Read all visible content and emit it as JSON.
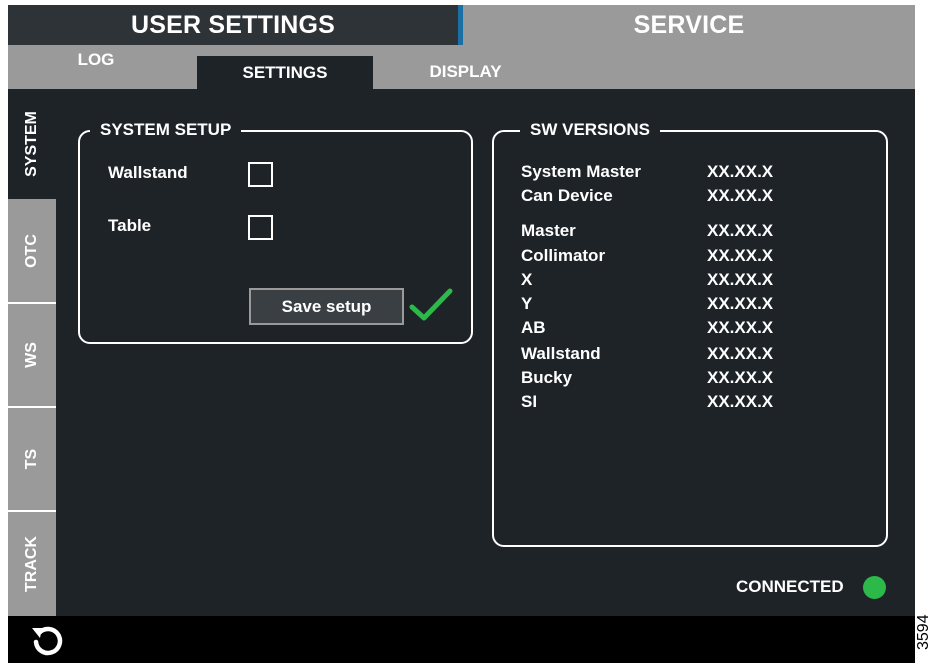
{
  "header": {
    "user_settings": "USER SETTINGS",
    "service": "SERVICE"
  },
  "subtabs": [
    "LOG",
    "SETTINGS",
    "DISPLAY"
  ],
  "sidetabs": [
    "SYSTEM",
    "OTC",
    "WS",
    "TS",
    "TRACK"
  ],
  "active_sidetab": "SYSTEM",
  "active_subtab": "SETTINGS",
  "system_setup": {
    "title": "SYSTEM SETUP",
    "wallstand_label": "Wallstand",
    "wallstand_checked": false,
    "table_label": "Table",
    "table_checked": false,
    "save_label": "Save setup"
  },
  "sw_versions": {
    "title": "SW VERSIONS",
    "rows": [
      {
        "name": "System Master",
        "version": "XX.XX.X"
      },
      {
        "name": "Can Device",
        "version": "XX.XX.X"
      },
      {
        "name": "Master",
        "version": "XX.XX.X"
      },
      {
        "name": "Collimator",
        "version": "XX.XX.X"
      },
      {
        "name": "X",
        "version": "XX.XX.X"
      },
      {
        "name": "Y",
        "version": "XX.XX.X"
      },
      {
        "name": "AB",
        "version": "XX.XX.X"
      },
      {
        "name": "Wallstand",
        "version": "XX.XX.X"
      },
      {
        "name": "Bucky",
        "version": "XX.XX.X"
      },
      {
        "name": "SI",
        "version": "XX.XX.X"
      }
    ]
  },
  "status": {
    "text": "CONNECTED",
    "color": "#2db84a"
  },
  "colors": {
    "background": "#1e2328",
    "tab_inactive": "#9a9a9a",
    "accent": "#1a6fa5",
    "checkmark": "#2db84a"
  },
  "icons": {
    "checkmark": "checkmark-icon",
    "reset": "reset-icon"
  },
  "figure_code": "3594"
}
